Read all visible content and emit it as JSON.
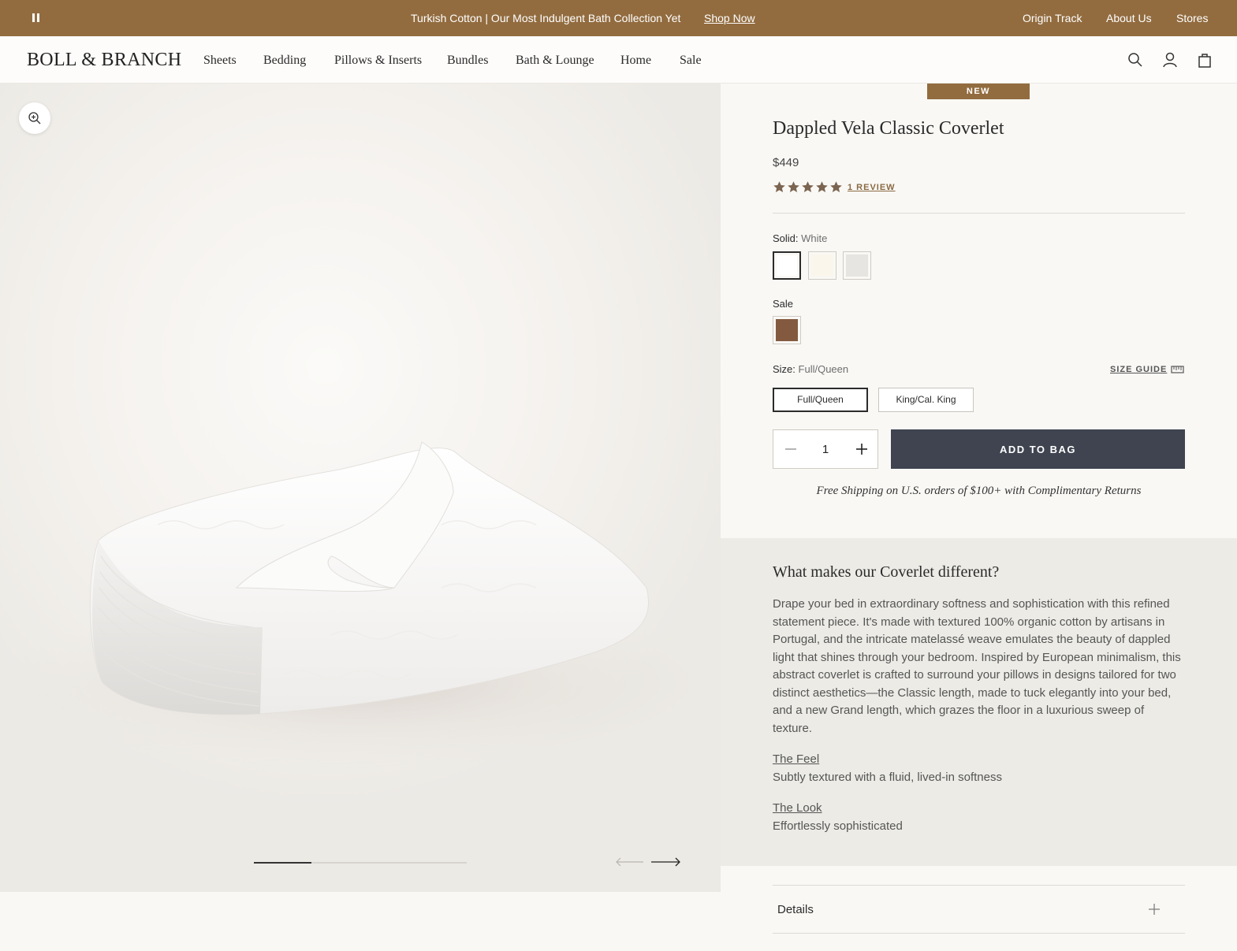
{
  "announcement": {
    "promo_text": "Turkish Cotton | Our Most Indulgent Bath Collection Yet",
    "cta": "Shop Now",
    "links": [
      "Origin Track",
      "About Us",
      "Stores"
    ],
    "pause_icon": "pause-icon",
    "bg_color": "#926c3f"
  },
  "nav": {
    "logo": "BOLL & BRANCH",
    "menu": [
      "Sheets",
      "Bedding",
      "Pillows & Inserts",
      "Bundles",
      "Bath & Lounge",
      "Home",
      "Sale"
    ],
    "icons": [
      "search-icon",
      "account-icon",
      "bag-icon"
    ]
  },
  "gallery": {
    "zoom_icon": "zoom-in-icon",
    "slide_progress": 0.27,
    "prev_icon": "arrow-left-icon",
    "next_icon": "arrow-right-icon"
  },
  "product": {
    "badge": "NEW",
    "title": "Dappled Vela Classic Coverlet",
    "price": "$449",
    "rating": 5,
    "reviews_label": "1 REVIEW",
    "solid_label": "Solid:",
    "solid_value": "White",
    "solid_swatches": [
      {
        "name": "White",
        "color": "#ffffff",
        "selected": true
      },
      {
        "name": "Ivory",
        "color": "#faf6ec",
        "selected": false
      },
      {
        "name": "Light Gray",
        "color": "#e6e5e2",
        "selected": false
      }
    ],
    "sale_label": "Sale",
    "sale_swatches": [
      {
        "name": "Brown",
        "color": "#835a3f",
        "selected": false
      }
    ],
    "size_label": "Size:",
    "size_value": "Full/Queen",
    "size_guide": "SIZE GUIDE",
    "sizes": [
      {
        "label": "Full/Queen",
        "selected": true
      },
      {
        "label": "King/Cal. King",
        "selected": false
      }
    ],
    "quantity": "1",
    "add_to_bag": "ADD TO BAG",
    "shipping_note": "Free Shipping on U.S. orders of $100+ with Complimentary Returns"
  },
  "description": {
    "heading": "What makes our Coverlet different?",
    "body": "Drape your bed in extraordinary softness and sophistication with this refined statement piece. It's made with textured 100% organic cotton by artisans in Portugal, and the intricate matelassé weave emulates the beauty of dappled light that shines through your bedroom. Inspired by European minimalism, this abstract coverlet is crafted to surround your pillows in designs tailored for two distinct aesthetics—the Classic length, made to tuck elegantly into your bed, and a new Grand length, which grazes the floor in a luxurious sweep of texture.",
    "features": [
      {
        "title": "The Feel",
        "text": "Subtly textured with a fluid, lived-in softness"
      },
      {
        "title": "The Look",
        "text": "Effortlessly sophisticated"
      }
    ]
  },
  "accordion": {
    "details_label": "Details"
  }
}
